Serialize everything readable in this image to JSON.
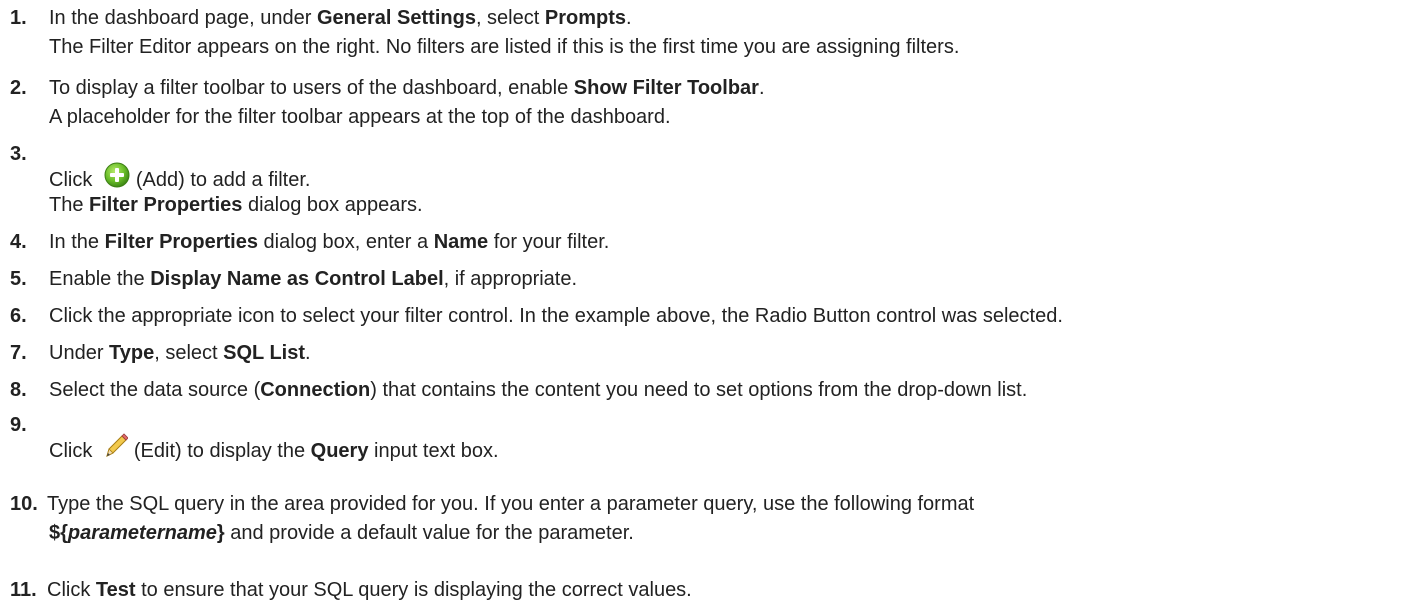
{
  "steps": [
    {
      "num": "1.",
      "line1": [
        "In the dashboard page, under ",
        "General Settings",
        ", select ",
        "Prompts",
        "."
      ],
      "line2": "The Filter Editor appears on the right. No filters are listed if this is the first time you are assigning filters."
    },
    {
      "num": "2.",
      "line1": [
        "To display a filter toolbar to users of the dashboard, enable ",
        "Show Filter Toolbar",
        "."
      ],
      "line2": "A placeholder for the filter toolbar appears at the top of the dashboard."
    },
    {
      "num": "3.",
      "line1": [
        "Click ",
        "(Add) to add a filter."
      ],
      "line2": [
        "The ",
        "Filter Properties",
        " dialog box appears."
      ],
      "icon": "add-icon"
    },
    {
      "num": "4.",
      "line1": [
        "In the ",
        "Filter Properties",
        " dialog box, enter a ",
        "Name",
        " for your filter."
      ]
    },
    {
      "num": "5.",
      "line1": [
        "Enable the ",
        "Display Name as Control Label",
        ", if appropriate."
      ]
    },
    {
      "num": "6.",
      "line1": [
        "Click the appropriate icon to select your filter control. In the example above, the Radio Button control was selected."
      ]
    },
    {
      "num": "7.",
      "line1": [
        "Under ",
        "Type",
        ", select ",
        "SQL List",
        "."
      ]
    },
    {
      "num": "8.",
      "line1": [
        "Select the data source (",
        "Connection",
        ") that contains the content you need to set options from the drop-down list."
      ]
    },
    {
      "num": "9.",
      "line1": [
        "Click ",
        "(Edit) to display the ",
        "Query",
        " input text box."
      ],
      "icon": "pencil-icon"
    },
    {
      "num": "10.",
      "line1": [
        "Type the SQL query in the area provided for you. If you enter a parameter query, use the following format"
      ],
      "line2": [
        "${",
        "parametername",
        "}",
        " and provide a default value for the parameter."
      ]
    },
    {
      "num": "11.",
      "line1": [
        "Click ",
        "Test",
        " to ensure that your SQL query is displaying the correct values."
      ]
    }
  ],
  "colors": {
    "text": "#222222",
    "add_icon_green": "#6cbf2a"
  }
}
